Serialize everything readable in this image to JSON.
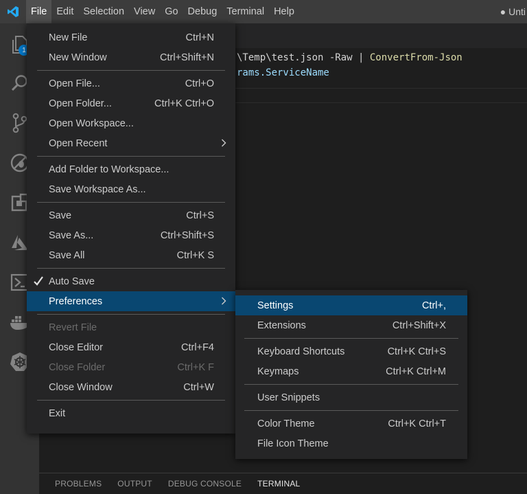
{
  "titlebar": {
    "app_icon": "vscode-logo-icon",
    "menus": [
      {
        "label": "File",
        "active": true
      },
      {
        "label": "Edit"
      },
      {
        "label": "Selection"
      },
      {
        "label": "View"
      },
      {
        "label": "Go"
      },
      {
        "label": "Debug"
      },
      {
        "label": "Terminal"
      },
      {
        "label": "Help"
      }
    ],
    "right_text": "● Unti"
  },
  "activitybar": {
    "icons": [
      "files-icon",
      "search-icon",
      "source-control-icon",
      "debug-icon",
      "extensions-icon",
      "azure-icon",
      "powershell-icon",
      "docker-icon",
      "kubernetes-icon"
    ],
    "files_badge": "1"
  },
  "editor": {
    "line1": {
      "path": "\\Temp\\test.json -Raw | ",
      "cmd": "ConvertFrom-Json"
    },
    "line2": {
      "prop": "rams.ServiceName"
    }
  },
  "file_menu": {
    "groups": [
      [
        {
          "label": "New File",
          "shortcut": "Ctrl+N"
        },
        {
          "label": "New Window",
          "shortcut": "Ctrl+Shift+N"
        }
      ],
      [
        {
          "label": "Open File...",
          "shortcut": "Ctrl+O"
        },
        {
          "label": "Open Folder...",
          "shortcut": "Ctrl+K Ctrl+O"
        },
        {
          "label": "Open Workspace...",
          "shortcut": ""
        },
        {
          "label": "Open Recent",
          "shortcut": "",
          "submenu": true
        }
      ],
      [
        {
          "label": "Add Folder to Workspace...",
          "shortcut": ""
        },
        {
          "label": "Save Workspace As...",
          "shortcut": ""
        }
      ],
      [
        {
          "label": "Save",
          "shortcut": "Ctrl+S"
        },
        {
          "label": "Save As...",
          "shortcut": "Ctrl+Shift+S"
        },
        {
          "label": "Save All",
          "shortcut": "Ctrl+K S"
        }
      ],
      [
        {
          "label": "Auto Save",
          "shortcut": "",
          "checked": true
        },
        {
          "label": "Preferences",
          "shortcut": "",
          "submenu": true,
          "selected": true
        }
      ],
      [
        {
          "label": "Revert File",
          "shortcut": "",
          "disabled": true
        },
        {
          "label": "Close Editor",
          "shortcut": "Ctrl+F4"
        },
        {
          "label": "Close Folder",
          "shortcut": "Ctrl+K F",
          "disabled": true
        },
        {
          "label": "Close Window",
          "shortcut": "Ctrl+W"
        }
      ],
      [
        {
          "label": "Exit",
          "shortcut": ""
        }
      ]
    ]
  },
  "preferences_menu": {
    "groups": [
      [
        {
          "label": "Settings",
          "shortcut": "Ctrl+,",
          "selected": true
        },
        {
          "label": "Extensions",
          "shortcut": "Ctrl+Shift+X"
        }
      ],
      [
        {
          "label": "Keyboard Shortcuts",
          "shortcut": "Ctrl+K Ctrl+S"
        },
        {
          "label": "Keymaps",
          "shortcut": "Ctrl+K Ctrl+M"
        }
      ],
      [
        {
          "label": "User Snippets",
          "shortcut": ""
        }
      ],
      [
        {
          "label": "Color Theme",
          "shortcut": "Ctrl+K Ctrl+T"
        },
        {
          "label": "File Icon Theme",
          "shortcut": ""
        }
      ]
    ]
  },
  "panel": {
    "tabs": [
      {
        "label": "PROBLEMS"
      },
      {
        "label": "OUTPUT"
      },
      {
        "label": "DEBUG CONSOLE"
      },
      {
        "label": "TERMINAL",
        "active": true
      }
    ]
  },
  "colors": {
    "menu_bg": "#252526",
    "selection": "#094771",
    "accent": "#007acc",
    "vscode_logo": "#23a9f2"
  }
}
